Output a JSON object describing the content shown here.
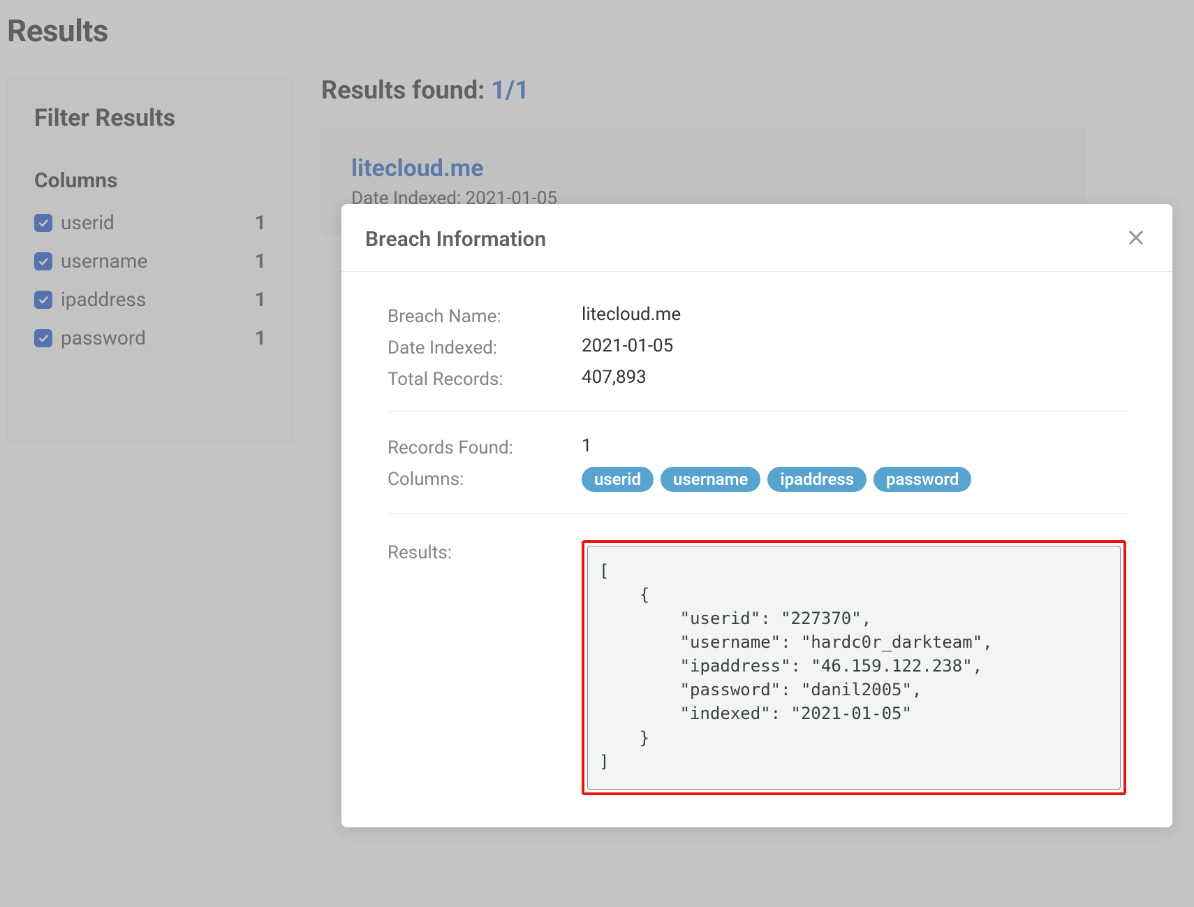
{
  "page": {
    "title": "Results"
  },
  "sidebar": {
    "heading": "Filter Results",
    "columnsHeading": "Columns",
    "items": [
      {
        "label": "userid",
        "count": "1"
      },
      {
        "label": "username",
        "count": "1"
      },
      {
        "label": "ipaddress",
        "count": "1"
      },
      {
        "label": "password",
        "count": "1"
      }
    ]
  },
  "main": {
    "foundLabel": "Results found: ",
    "foundCount": "1/1",
    "card": {
      "title": "litecloud.me",
      "sub": "Date Indexed: 2021-01-05"
    }
  },
  "modal": {
    "title": "Breach Information",
    "labels": {
      "breachName": "Breach Name:",
      "dateIndexed": "Date Indexed:",
      "totalRecords": "Total Records:",
      "recordsFound": "Records Found:",
      "columns": "Columns:",
      "results": "Results:"
    },
    "values": {
      "breachName": "litecloud.me",
      "dateIndexed": "2021-01-05",
      "totalRecords": "407,893",
      "recordsFound": "1"
    },
    "columns": [
      "userid",
      "username",
      "ipaddress",
      "password"
    ],
    "resultsJson": "[\n    {\n        \"userid\": \"227370\",\n        \"username\": \"hardc0r_darkteam\",\n        \"ipaddress\": \"46.159.122.238\",\n        \"password\": \"danil2005\",\n        \"indexed\": \"2021-01-05\"\n    }\n]"
  }
}
